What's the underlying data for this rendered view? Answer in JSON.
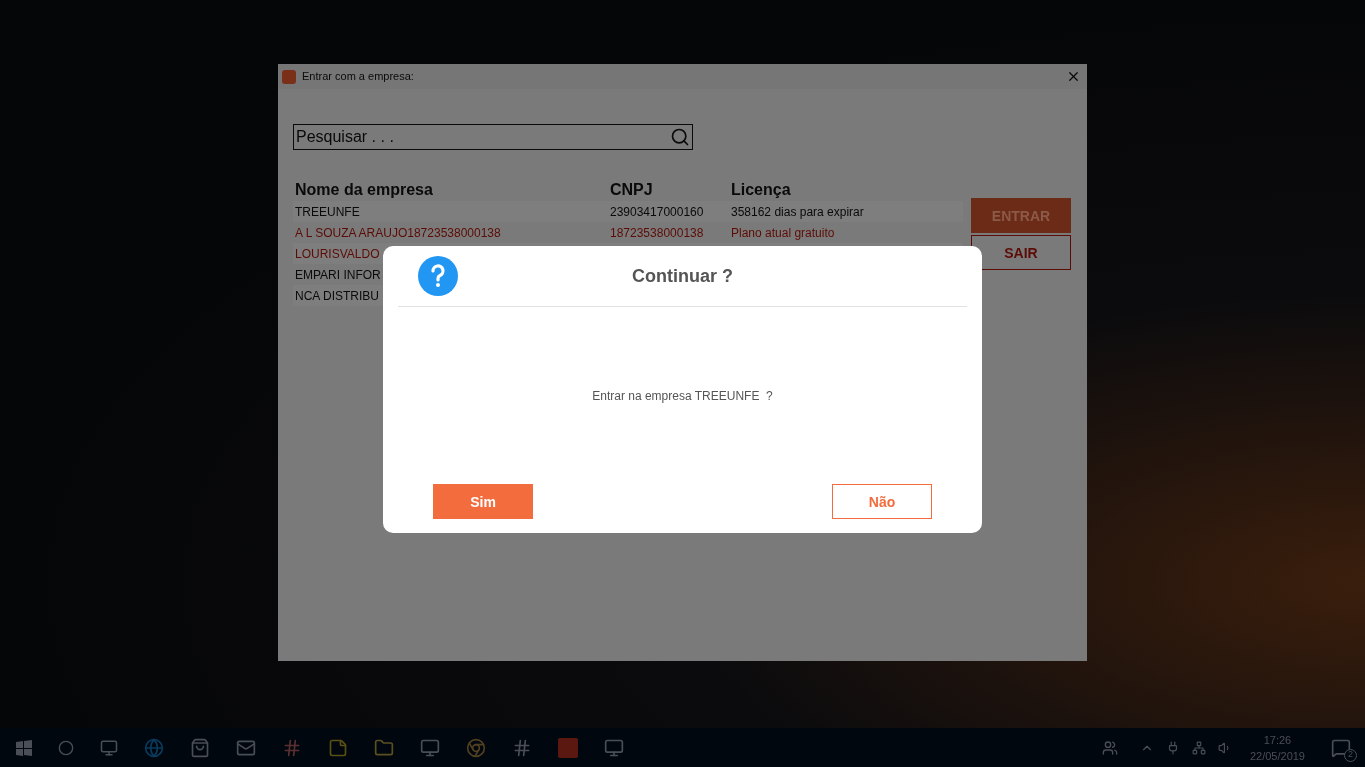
{
  "window": {
    "title": "Entrar com a empresa:"
  },
  "search": {
    "placeholder": "Pesquisar . . ."
  },
  "table": {
    "columns": [
      "Nome da empresa",
      "CNPJ",
      "Licença"
    ],
    "rows": [
      {
        "cells": [
          "TREEUNFE",
          "23903417000160",
          "358162 dias para expirar"
        ],
        "warning": false
      },
      {
        "cells": [
          "A L SOUZA ARAUJO18723538000138",
          "18723538000138",
          "Plano atual gratuito"
        ],
        "warning": true
      },
      {
        "cells": [
          "LOURISVALDO"
        ],
        "warning": true
      },
      {
        "cells": [
          "EMPARI INFOR"
        ],
        "warning": false
      },
      {
        "cells": [
          "NCA DISTRIBU"
        ],
        "warning": false
      }
    ]
  },
  "actions": [
    {
      "label": "ENTRAR",
      "kind": "primary"
    },
    {
      "label": "SAIR",
      "kind": "outline"
    }
  ],
  "dialog": {
    "title": "Continuar ?",
    "message": "Entrar na empresa TREEUNFE  ?",
    "buttons": [
      {
        "label": "Sim",
        "kind": "primary"
      },
      {
        "label": "Não",
        "kind": "outline"
      }
    ]
  },
  "taskbar": {
    "time": "17:26",
    "date": "22/05/2019",
    "notifications": "2"
  }
}
